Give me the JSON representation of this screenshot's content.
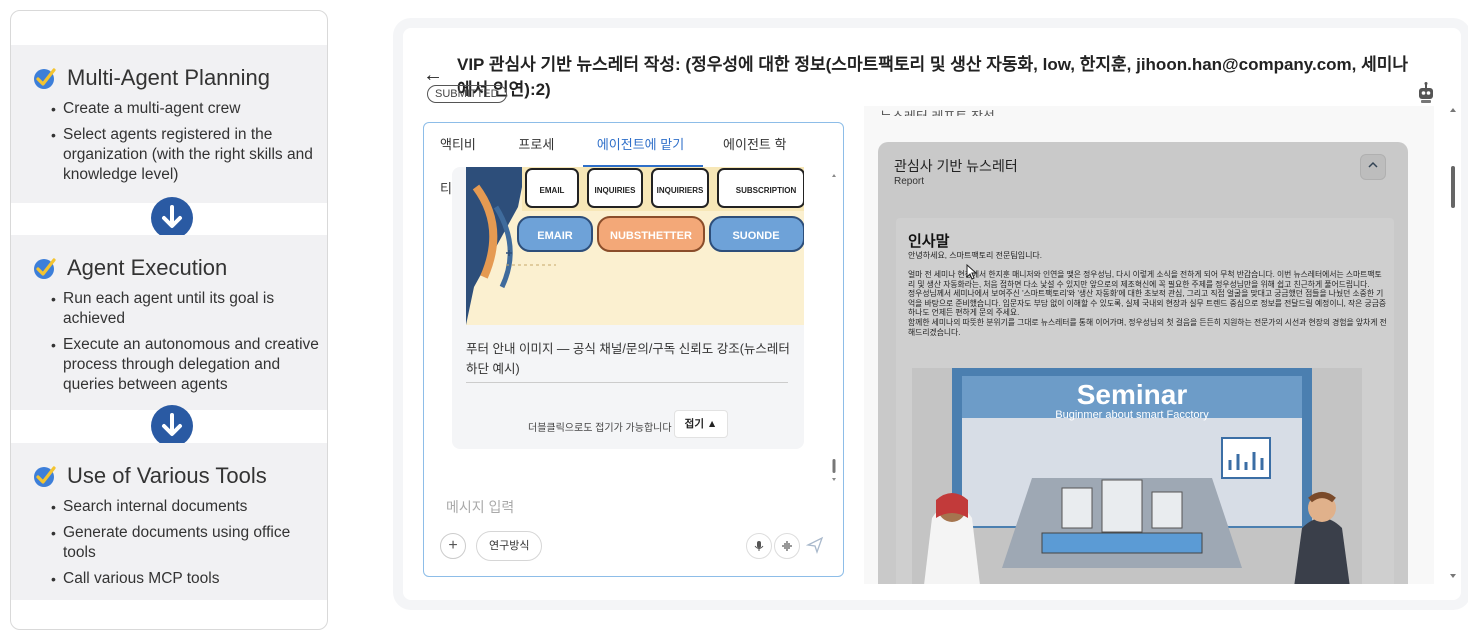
{
  "left_panel": {
    "sections": [
      {
        "title": "Multi-Agent Planning",
        "bullets": [
          "Create a multi-agent crew",
          "Select agents registered in the organization (with the right skills and knowledge level)"
        ]
      },
      {
        "title": "Agent Execution",
        "bullets": [
          "Run each agent until its goal is achieved",
          "Execute an autonomous and creative process through delegation and queries between agents"
        ]
      },
      {
        "title": "Use of Various Tools",
        "bullets": [
          "Search internal documents",
          "Generate documents using office tools",
          "Call various MCP tools"
        ]
      }
    ],
    "colors": {
      "accent": "#2a5aa3",
      "check": "#3d7fd9",
      "check_tick": "#f4c430"
    }
  },
  "app": {
    "title": "VIP 관심사 기반 뉴스레터 작성: (정우성에 대한 정보(스마트팩토리 및 생산 자동화, low, 한지훈, jihoon.han@company.com, 세미나에서 인연):2)",
    "status_badge": "SUBMITTED",
    "tabs": [
      "액티비티",
      "프로세스",
      "에이전트에 맡기기",
      "에이전트 학습"
    ],
    "active_tab": "에이전트에 맡기기",
    "chat": {
      "image_labels": {
        "top": [
          "EMAIL",
          "INQUIRIES",
          "INQUIRIERS",
          "SUBSCRIPTION"
        ],
        "bottom": [
          "EMAIR",
          "NUBSTHETTER",
          "SUONDE"
        ]
      },
      "image_caption": "푸터 안내 이미지 — 공식 채널/문의/구독 신뢰도 강조(뉴스레터 하단 예시)",
      "fold_hint": "더블클릭으로도 접기가 가능합니다",
      "fold_button": "접기 ▲",
      "input_placeholder": "메시지 입력",
      "research_button": "연구방식",
      "plus_button": "+"
    },
    "report": {
      "top_text": "뉴스레터 레포트 작성",
      "card_title": "관심사 기반 뉴스레터",
      "card_subtitle": "Report",
      "doc_heading": "인사말",
      "doc_greeting": "안녕하세요, 스마트팩토리 전문팀입니다.",
      "doc_body": [
        "얼마 전 세미나 현장에서 한지훈 매니저와 인연을 맺은 정우성님, 다시 이렇게 소식을 전하게 되어 무척 반갑습니다. 이번 뉴스레터에서는 스마트팩토리 및 생산 자동화라는, 처음 접하면 다소 낯설 수 있지만 앞으로의 제조혁신에 꼭 필요한 주제를 정우성님만을 위해 쉽고 친근하게 풀어드립니다.",
        "정우성님께서 세미나에서 보여주신 '스마트팩토리'와 '생산 자동화'에 대한 초보적 관심, 그리고 직접 얼굴을 맞대고 궁금했던 점들을 나눴던 소중한 기억을 바탕으로 준비했습니다. 입문자도 부담 없이 이해할 수 있도록, 실제 국내외 현장과 실무 트렌드 중심으로 정보를 전달드릴 예정이니, 작은 궁금증 하나도 언제든 편하게 문의 주세요.",
        "함께한 세미나의 따뜻한 분위기를 그대로 뉴스레터를 통해 이어가며, 정우성님의 첫 걸음을 든든히 지원하는 전문가의 시선과 현장의 경험을 앞차게 전해드리겠습니다."
      ],
      "seminar_title": "Seminar",
      "seminar_subtitle": "Buginmer about smart Facctory"
    }
  }
}
